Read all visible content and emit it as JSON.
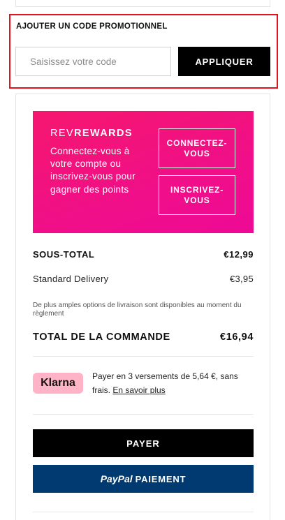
{
  "promo": {
    "title": "AJOUTER UN CODE PROMOTIONNEL",
    "placeholder": "Saisissez votre code",
    "apply_label": "APPLIQUER"
  },
  "rewards": {
    "brand_prefix": "REV",
    "brand_suffix": "REWARDS",
    "text": "Connectez-vous à votre compte ou inscrivez-vous pour gagner des points",
    "connect_label": "CONNECTEZ-VOUS",
    "register_label": "INSCRIVEZ-VOUS"
  },
  "totals": {
    "subtotal_label": "SOUS-TOTAL",
    "subtotal_value": "€12,99",
    "delivery_label": "Standard Delivery",
    "delivery_value": "€3,95",
    "delivery_note": "De plus amples options de livraison sont disponibles au moment du règlement",
    "total_label": "TOTAL DE LA COMMANDE",
    "total_value": "€16,94"
  },
  "klarna": {
    "logo": "Klarna",
    "text": "Payer en 3 versements de 5,64 €, sans frais.",
    "link": "En savoir plus"
  },
  "actions": {
    "pay_label": "PAYER",
    "paypal_logo": "PayPal",
    "paypal_label": "PAIEMENT"
  },
  "colors": {
    "highlight_border": "#e0141e",
    "rewards_pink": "#f00f88",
    "klarna_pink": "#ffb3c7",
    "paypal_blue": "#003a70"
  }
}
